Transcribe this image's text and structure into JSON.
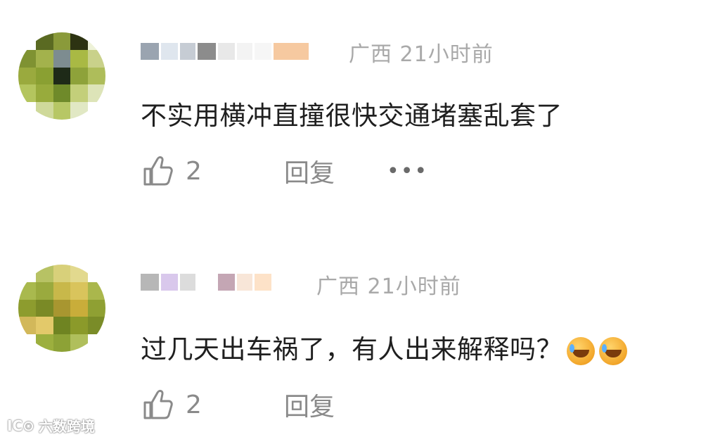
{
  "comments": [
    {
      "location": "广西",
      "time": "21小时前",
      "text": "不实用横冲直撞很快交通堵塞乱套了",
      "likes": "2",
      "reply_label": "回复",
      "more_label": "•••",
      "avatar_colors": [
        "#ffffff",
        "#5a6a22",
        "#8a9a3a",
        "#2d3312",
        "#eef2d8",
        "#7f9232",
        "#a3b24c",
        "#7d8c90",
        "#a9b944",
        "#c9d18a",
        "#9aaa3e",
        "#8aa032",
        "#1e2a18",
        "#8ea23a",
        "#aebd5a",
        "#b4c55e",
        "#98ab3c",
        "#6f8a2a",
        "#c3cf7a",
        "#dde4b8",
        "#ffffff",
        "#cfd99a",
        "#b7c765",
        "#e1e8c4",
        "#ffffff"
      ],
      "username_colors": [
        "#9aa4b0",
        "#dfe6ee",
        "#c6ccd4",
        "#8c8c8c",
        "#e8e8e8",
        "#f3f3f3",
        "#f6f6f6",
        "#f6c9a0"
      ]
    },
    {
      "location": "广西",
      "time": "21小时前",
      "text": "过几天出车祸了，有人出来解释吗？",
      "likes": "2",
      "reply_label": "回复",
      "avatar_colors": [
        "#ffffff",
        "#b7c264",
        "#d8d07a",
        "#e2d98e",
        "#ffffff",
        "#a9b94e",
        "#9aaa3e",
        "#c8b84a",
        "#d9c45c",
        "#aab74c",
        "#8d9c2e",
        "#7a8a26",
        "#a89630",
        "#c9ad3a",
        "#8fa033",
        "#d2b85a",
        "#e3c96a",
        "#6f8422",
        "#8b9a2a",
        "#7a8c28",
        "#ffffff",
        "#9caf3e",
        "#8da236",
        "#b0bf5c",
        "#ffffff"
      ],
      "username_colors": [
        "#b7b7b7",
        "#d9c8ec",
        "#dcdcdc",
        "#ffffff",
        "#c4a6b4",
        "#f8e6d8",
        "#fde2c8"
      ]
    }
  ],
  "watermark": {
    "logo": "IC⊙",
    "text": "六数跨境"
  }
}
